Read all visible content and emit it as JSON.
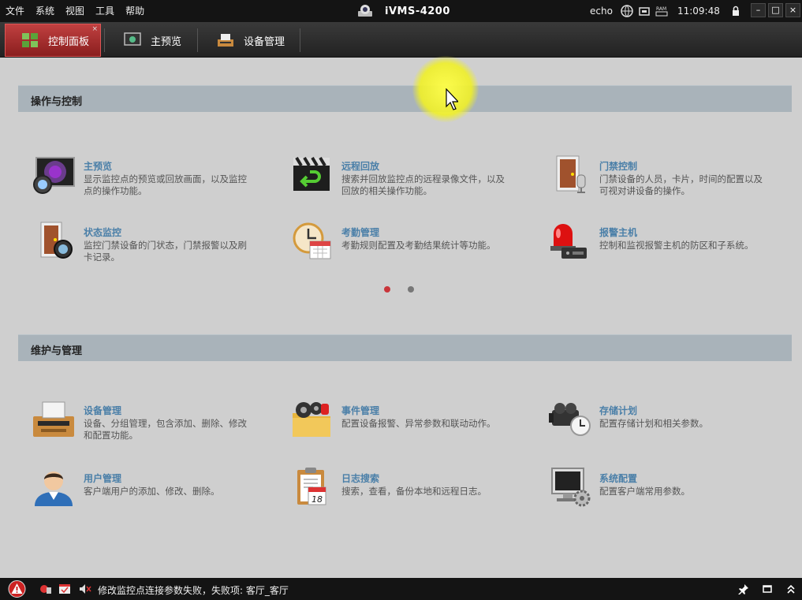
{
  "menu": [
    "文件",
    "系统",
    "视图",
    "工具",
    "帮助"
  ],
  "app": {
    "title": "iVMS-4200"
  },
  "status": {
    "user": "echo",
    "ram_label": "RAM",
    "time": "11:09:48"
  },
  "window_controls": {
    "minimize": "–",
    "maximize": "□",
    "close": "×"
  },
  "tabs": [
    {
      "label": "控制面板",
      "close": "×"
    },
    {
      "label": "主预览"
    },
    {
      "label": "设备管理"
    }
  ],
  "sections": [
    {
      "title": "操作与控制",
      "items": [
        {
          "title": "主预览",
          "desc": "显示监控点的预览或回放画面，以及监控点的操作功能。"
        },
        {
          "title": "远程回放",
          "desc": "搜索并回放监控点的远程录像文件，以及回放的相关操作功能。"
        },
        {
          "title": "门禁控制",
          "desc": "门禁设备的人员，卡片，时间的配置以及可视对讲设备的操作。"
        },
        {
          "title": "状态监控",
          "desc": "监控门禁设备的门状态，门禁报警以及刷卡记录。"
        },
        {
          "title": "考勤管理",
          "desc": "考勤规则配置及考勤结果统计等功能。"
        },
        {
          "title": "报警主机",
          "desc": "控制和监视报警主机的防区和子系统。"
        }
      ]
    },
    {
      "title": "维护与管理",
      "items": [
        {
          "title": "设备管理",
          "desc": "设备、分组管理，包含添加、删除、修改和配置功能。"
        },
        {
          "title": "事件管理",
          "desc": "配置设备报警、异常参数和联动动作。"
        },
        {
          "title": "存储计划",
          "desc": "配置存储计划和相关参数。"
        },
        {
          "title": "用户管理",
          "desc": "客户端用户的添加、修改、删除。"
        },
        {
          "title": "日志搜索",
          "desc": "搜索，查看，备份本地和远程日志。"
        },
        {
          "title": "系统配置",
          "desc": "配置客户端常用参数。"
        }
      ]
    }
  ],
  "pager": {
    "active_page": 1,
    "pages": 2,
    "colors": {
      "active": "#c9353a",
      "inactive": "#777777"
    }
  },
  "calendar_day": "18",
  "statusbar": {
    "message": "修改监控点连接参数失败，失败项: 客厅_客厅"
  },
  "colors": {
    "accent": "#4a7fa8",
    "tab_active": "#b83434",
    "section_bg": "#a9b3ba"
  }
}
